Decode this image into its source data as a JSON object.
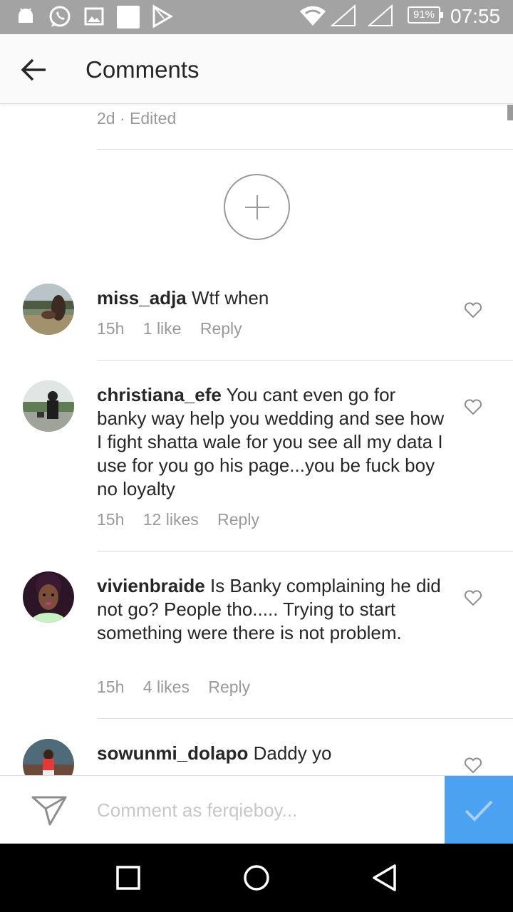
{
  "status_bar": {
    "battery": "91%",
    "time": "07:55",
    "icons": [
      "android-icon",
      "whatsapp-icon",
      "gallery-icon",
      "square-notification-icon",
      "play-store-icon",
      "wifi-icon",
      "signal-icon",
      "signal-icon"
    ]
  },
  "app_bar": {
    "title": "Comments",
    "back_icon": "back-arrow-icon"
  },
  "previous_comment": {
    "meta": "2d · Edited"
  },
  "load_more_icon": "plus-circle-icon",
  "comments": [
    {
      "username": "miss_adja",
      "text": "Wtf when",
      "time": "15h",
      "likes": "1 like",
      "reply": "Reply"
    },
    {
      "username": "christiana_efe",
      "text": "You cant even go for banky way help you wedding and see how I fight shatta wale for you see all my data I use for you go his page...you be fuck boy no loyalty",
      "time": "15h",
      "likes": "12 likes",
      "reply": "Reply"
    },
    {
      "username": "vivienbraide",
      "text": "Is Banky complaining he did not go? People tho..... Trying to start something were there is not problem.",
      "time": "15h",
      "likes": "4 likes",
      "reply": "Reply"
    },
    {
      "username": "sowunmi_dolapo",
      "text": "Daddy yo",
      "time": "",
      "likes": "",
      "reply": ""
    }
  ],
  "input_bar": {
    "placeholder": "Comment as ferqieboy...",
    "send_icon": "paper-plane-icon",
    "post_icon": "checkmark-icon",
    "accent": "#4aa2f0"
  },
  "nav_bar": {
    "icons": [
      "recents-square-icon",
      "home-circle-icon",
      "back-triangle-icon"
    ]
  }
}
